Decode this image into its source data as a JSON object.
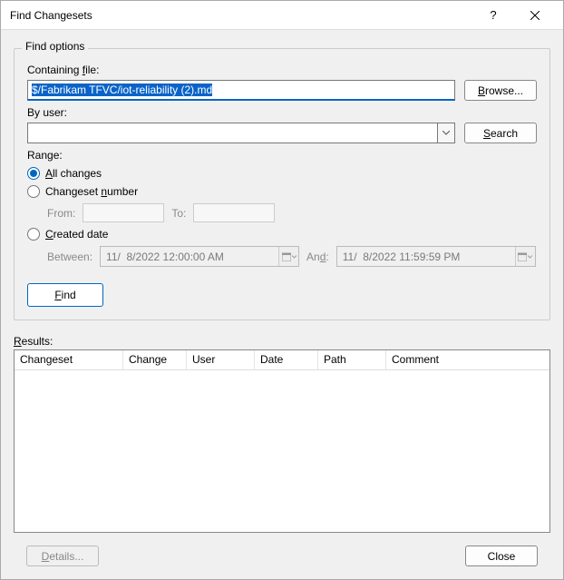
{
  "window": {
    "title": "Find Changesets"
  },
  "group": {
    "title": "Find options"
  },
  "containingFile": {
    "label_pre": "Containing ",
    "label_u": "f",
    "label_post": "ile:",
    "value": "$/Fabrikam TFVC/iot-reliability (2).md",
    "browse_u": "B",
    "browse_post": "rowse..."
  },
  "byUser": {
    "label": "By user:",
    "value": "",
    "search_u": "S",
    "search_post": "earch"
  },
  "range": {
    "label": "Range:",
    "all_u": "A",
    "all_post": "ll changes",
    "changeset_pre": "Changeset ",
    "changeset_u": "n",
    "changeset_post": "umber",
    "from_label": "From:",
    "to_label": "To:",
    "created_u": "C",
    "created_post": "reated date",
    "between_label": "Between:",
    "between_value": "11/  8/2022 12:00:00 AM",
    "and_pre": "An",
    "and_u": "d",
    "and_post": ":",
    "and_value": "11/  8/2022 11:59:59 PM"
  },
  "findBtn": {
    "u": "F",
    "post": "ind"
  },
  "results": {
    "label_u": "R",
    "label_post": "esults:",
    "cols": {
      "changeset": "Changeset",
      "change": "Change",
      "user": "User",
      "date": "Date",
      "path": "Path",
      "comment": "Comment"
    }
  },
  "footer": {
    "details_u": "D",
    "details_post": "etails...",
    "close": "Close"
  }
}
